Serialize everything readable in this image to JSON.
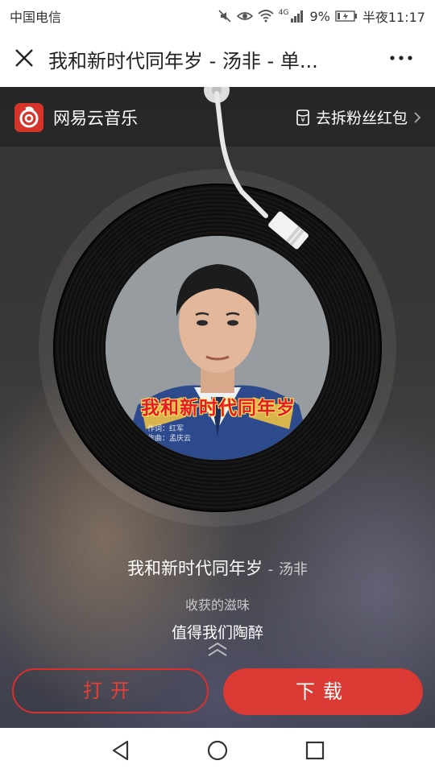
{
  "status_bar": {
    "carrier": "中国电信",
    "network": "4G",
    "battery": "9%",
    "time": "半夜11:17"
  },
  "title_bar": {
    "title": "我和新时代同年岁 - 汤非 - 单..."
  },
  "brand_bar": {
    "app_name": "网易云音乐",
    "red_packet": "去拆粉丝红包"
  },
  "cover": {
    "title": "我和新时代同年岁",
    "credits": [
      "作词：红军",
      "作曲：孟庆云"
    ]
  },
  "song": {
    "title": "我和新时代同年岁",
    "separator": "-",
    "artist": "汤非"
  },
  "lyrics": {
    "previous": "收获的滋味",
    "current": "值得我们陶醉"
  },
  "buttons": {
    "open": "打开",
    "download": "下载"
  },
  "colors": {
    "accent": "#da3a33",
    "brand_red": "#d6342b"
  }
}
